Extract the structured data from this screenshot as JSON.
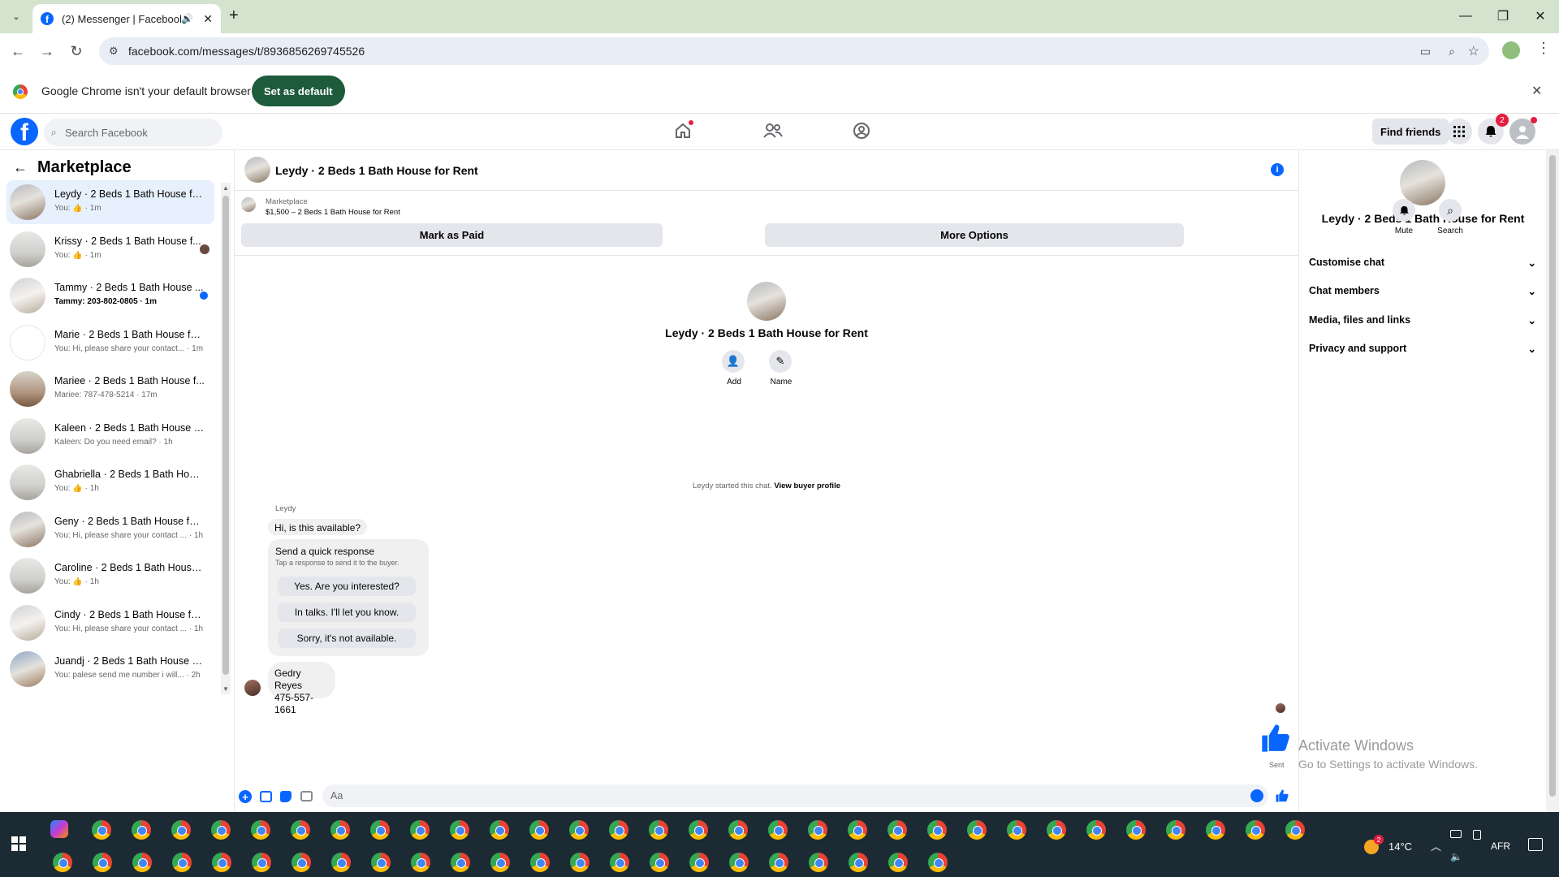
{
  "browser": {
    "tab_title": "(2) Messenger | Facebook",
    "url": "facebook.com/messages/t/8936856269745526",
    "infobar_message": "Google Chrome isn't your default browser",
    "infobar_button": "Set as default"
  },
  "fb_nav": {
    "search_placeholder": "Search Facebook",
    "find_friends": "Find friends",
    "notif_count": "2"
  },
  "sidebar": {
    "title": "Marketplace",
    "conversations": [
      {
        "name": "Leydy · 2 Beds 1 Bath House for...",
        "preview": "You: 👍 · 1m",
        "active": true
      },
      {
        "name": "Krissy · 2 Beds 1 Bath House f...",
        "preview": "You: 👍 · 1m"
      },
      {
        "name": "Tammy · 2 Beds 1 Bath House ...",
        "preview": "Tammy: 203-802-0805 · 1m",
        "unread": true
      },
      {
        "name": "Marie · 2 Beds 1 Bath House for...",
        "preview": "You: Hi, please share your contact... · 1m"
      },
      {
        "name": "Mariee · 2 Beds 1 Bath House f...",
        "preview": "Mariee: 787-478-5214 · 17m"
      },
      {
        "name": "Kaleen · 2 Beds 1 Bath House fo...",
        "preview": "Kaleen: Do you need email? · 1h"
      },
      {
        "name": "Ghabriella · 2 Beds 1 Bath Hous...",
        "preview": "You: 👍 · 1h"
      },
      {
        "name": "Geny · 2 Beds 1 Bath House for ...",
        "preview": "You: Hi, please share your contact ... · 1h"
      },
      {
        "name": "Caroline · 2 Beds 1 Bath House ...",
        "preview": "You: 👍 · 1h"
      },
      {
        "name": "Cindy · 2 Beds 1 Bath House for...",
        "preview": "You: Hi, please share your contact ... · 1h"
      },
      {
        "name": "Juandj · 2 Beds 1 Bath House fo...",
        "preview": "You: palese send me number i will... · 2h"
      }
    ]
  },
  "chat": {
    "title": "Leydy · 2 Beds 1 Bath House for Rent",
    "marketplace_label": "Marketplace",
    "listing": "$1,500 – 2 Beds 1 Bath House for Rent",
    "mark_paid": "Mark as Paid",
    "more_options": "More Options",
    "center_title": "Leydy · 2 Beds 1 Bath House for Rent",
    "add_label": "Add",
    "name_label": "Name",
    "started_text": "Leydy started this chat.",
    "view_buyer": "View buyer profile",
    "sender_name": "Leydy",
    "first_message": "Hi, is this available?",
    "quick_title": "Send a quick response",
    "quick_sub": "Tap a response to send it to the buyer.",
    "quick_responses": [
      "Yes. Are you interested?",
      "In talks. I'll let you know.",
      "Sorry, it's not available."
    ],
    "contact_name": "Gedry Reyes",
    "contact_phone": "475-557-1661",
    "sent_label": "Sent",
    "input_placeholder": "Aa"
  },
  "details": {
    "title": "Leydy · 2 Beds 1 Bath House for Rent",
    "mute": "Mute",
    "search": "Search",
    "sections": [
      "Customise chat",
      "Chat members",
      "Media, files and links",
      "Privacy and support"
    ]
  },
  "watermark": {
    "line1": "Activate Windows",
    "line2": "Go to Settings to activate Windows."
  },
  "taskbar": {
    "temp": "14°C",
    "lang": "AFR",
    "weather_badge": "2"
  },
  "colors": {
    "fb_blue": "#0866ff",
    "chrome_tabstrip": "#d3e3cd",
    "set_default_green": "#1e5b3a"
  }
}
